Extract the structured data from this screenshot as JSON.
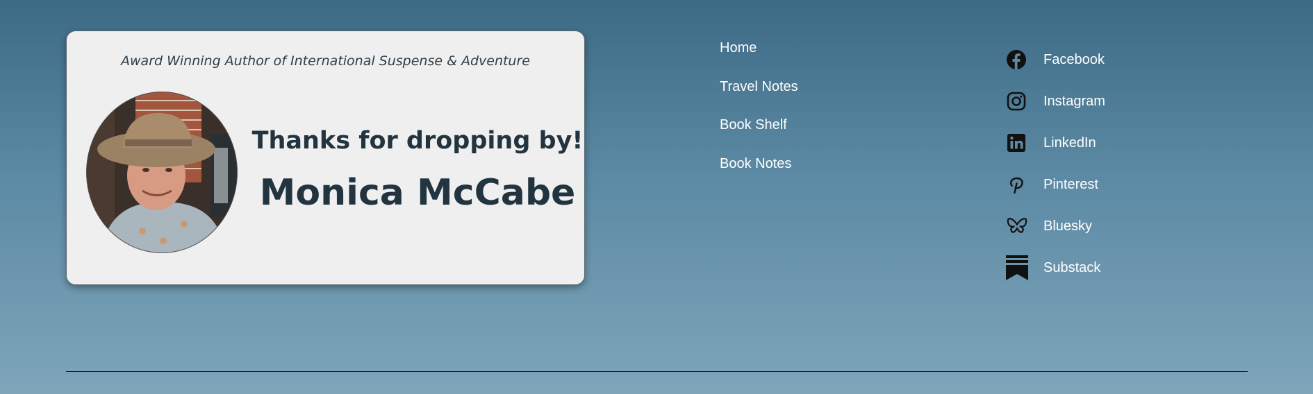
{
  "card": {
    "tagline": "Award Winning Author of International Suspense & Adventure",
    "greeting": "Thanks for dropping by!",
    "name": "Monica McCabe"
  },
  "nav": [
    {
      "label": "Home"
    },
    {
      "label": "Travel Notes"
    },
    {
      "label": "Book Shelf"
    },
    {
      "label": "Book Notes"
    }
  ],
  "social": [
    {
      "label": "Facebook",
      "icon": "facebook-icon"
    },
    {
      "label": "Instagram",
      "icon": "instagram-icon"
    },
    {
      "label": "LinkedIn",
      "icon": "linkedin-icon"
    },
    {
      "label": "Pinterest",
      "icon": "pinterest-icon"
    },
    {
      "label": "Bluesky",
      "icon": "bluesky-icon"
    },
    {
      "label": "Substack",
      "icon": "substack-icon"
    }
  ],
  "colors": {
    "heading": "#22343f",
    "card_bg": "#efefef",
    "link": "#ffffff"
  }
}
